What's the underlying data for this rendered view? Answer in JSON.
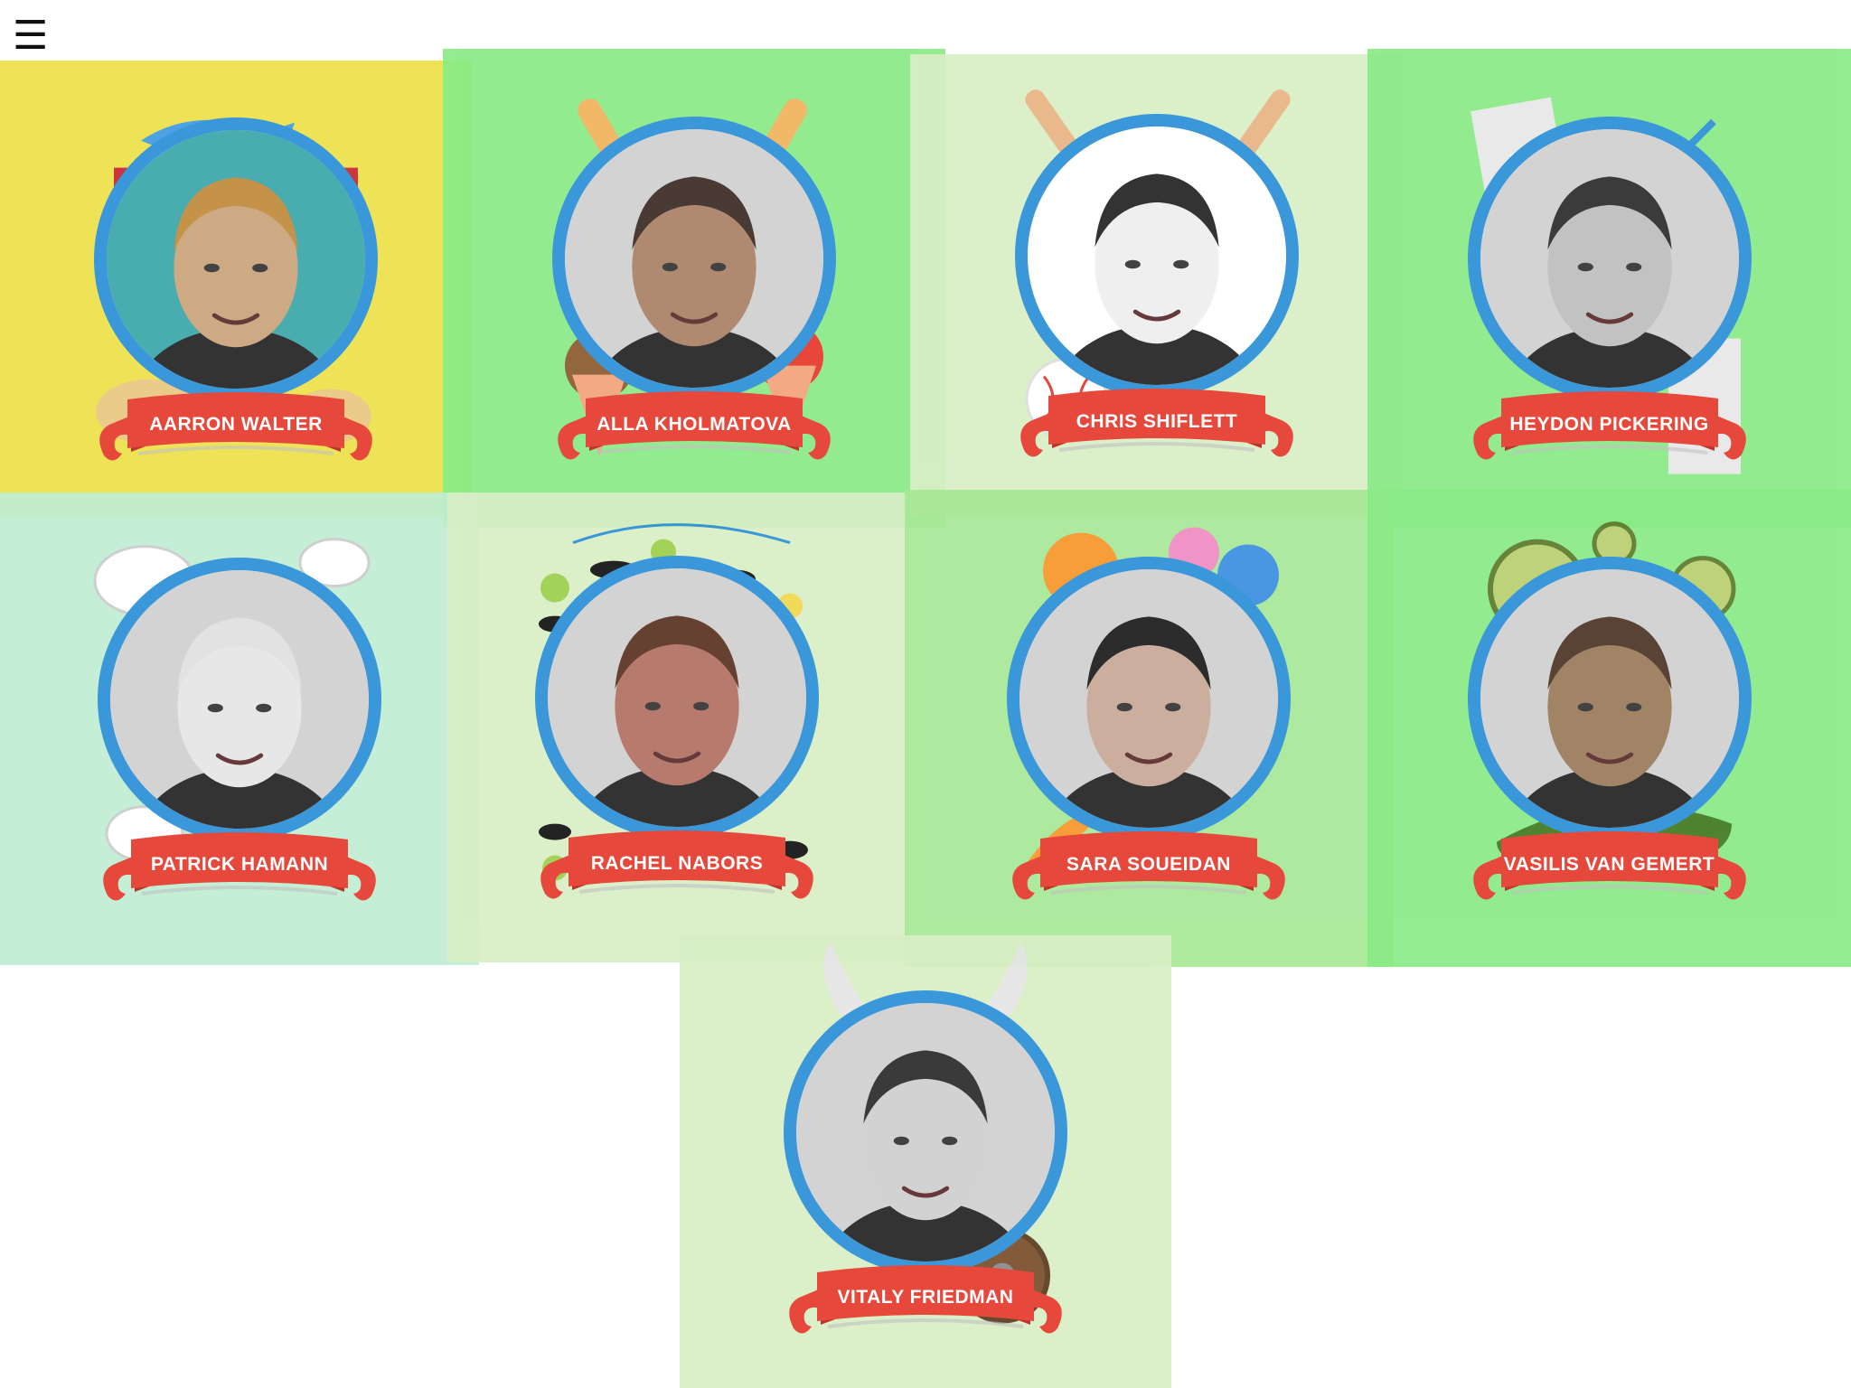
{
  "menu": {
    "label": "☰"
  },
  "speakers": [
    {
      "id": "aarron-walter",
      "name": "Aarron Walter",
      "bg": "#ede049",
      "ring": "#2a8fd6",
      "theme": "fish-awning-icon"
    },
    {
      "id": "alla-kholmatova",
      "name": "Alla Kholmatova",
      "bg": "#8aea86",
      "ring": "#2a8fd6",
      "theme": "ice-cream-icon"
    },
    {
      "id": "chris-shiflett",
      "name": "Chris Shiflett",
      "bg": "#d8eec5",
      "ring": "#2a8fd6",
      "theme": "baseball-icon"
    },
    {
      "id": "heydon-pickering",
      "name": "Heydon Pickering",
      "bg": "#8aea86",
      "ring": "#2a8fd6",
      "theme": "paper-pen-icon"
    },
    {
      "id": "patrick-hamann",
      "name": "Patrick Hamann",
      "bg": "#bfedd2",
      "ring": "#2a8fd6",
      "theme": "helmet-lightning-icon"
    },
    {
      "id": "rachel-nabors",
      "name": "Rachel Nabors",
      "bg": "#d8eec5",
      "ring": "#2a8fd6",
      "theme": "cats-trees-icon"
    },
    {
      "id": "sara-soueidan",
      "name": "Sara Soueidan",
      "bg": "#a7e896",
      "ring": "#2a8fd6",
      "theme": "owls-feathers-icon"
    },
    {
      "id": "vasilis-van-gemert",
      "name": "Vasilis van Gemert",
      "bg": "#8aea86",
      "ring": "#2a8fd6",
      "theme": "cucumber-icon"
    },
    {
      "id": "vitaly-friedman",
      "name": "Vitaly Friedman",
      "bg": "#d8eec5",
      "ring": "#2a8fd6",
      "theme": "viking-helmet-icon"
    }
  ],
  "colors": {
    "banner": "#e43a2b",
    "banner_dark": "#b8261b",
    "ring": "#2a8fd6"
  }
}
